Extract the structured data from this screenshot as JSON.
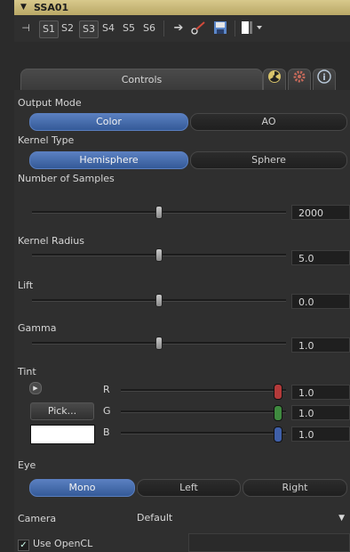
{
  "node": {
    "title": "SSA01",
    "collapse_icon": "triangle-down-icon"
  },
  "toolbar": {
    "pin_icon": "pin-icon",
    "slots": [
      "S1",
      "S2",
      "S3",
      "S4",
      "S5",
      "S6"
    ],
    "selected_slots": [
      "S1",
      "S3"
    ],
    "icons": [
      "arrow-right-icon",
      "pick-icon",
      "save-icon",
      "view-icon"
    ]
  },
  "tabs": {
    "controls_label": "Controls",
    "icons": [
      "radiation-icon",
      "gear-icon",
      "info-icon"
    ]
  },
  "output_mode": {
    "label": "Output Mode",
    "options": [
      "Color",
      "AO"
    ],
    "selected": "Color"
  },
  "kernel_type": {
    "label": "Kernel Type",
    "options": [
      "Hemisphere",
      "Sphere"
    ],
    "selected": "Hemisphere"
  },
  "sliders": [
    {
      "label": "Number of Samples",
      "value": "2000"
    },
    {
      "label": "Kernel Radius",
      "value": "5.0"
    },
    {
      "label": "Lift",
      "value": "0.0"
    },
    {
      "label": "Gamma",
      "value": "1.0"
    }
  ],
  "tint": {
    "label": "Tint",
    "pick_label": "Pick...",
    "swatch_color": "#ffffff",
    "channels": [
      {
        "name": "R",
        "value": "1.0",
        "color": "#b33a3a"
      },
      {
        "name": "G",
        "value": "1.0",
        "color": "#3f8a3f"
      },
      {
        "name": "B",
        "value": "1.0",
        "color": "#3f5fa8"
      }
    ]
  },
  "eye": {
    "label": "Eye",
    "options": [
      "Mono",
      "Left",
      "Right"
    ],
    "selected": "Mono"
  },
  "camera": {
    "label": "Camera",
    "value": "Default"
  },
  "use_opencl": {
    "label": "Use OpenCL",
    "checked": true
  }
}
